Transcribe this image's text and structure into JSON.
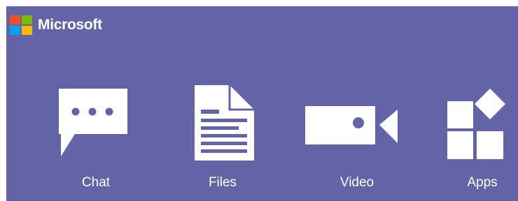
{
  "brand": {
    "name": "Microsoft",
    "logo_colors": [
      "#f25022",
      "#7fba00",
      "#00a4ef",
      "#ffb900"
    ]
  },
  "colors": {
    "background": "#6264a7",
    "foreground": "#ffffff"
  },
  "features": [
    {
      "label": "Chat",
      "icon": "chat-bubble-icon"
    },
    {
      "label": "Files",
      "icon": "document-icon"
    },
    {
      "label": "Video",
      "icon": "video-camera-icon"
    },
    {
      "label": "Apps",
      "icon": "apps-grid-icon"
    }
  ]
}
